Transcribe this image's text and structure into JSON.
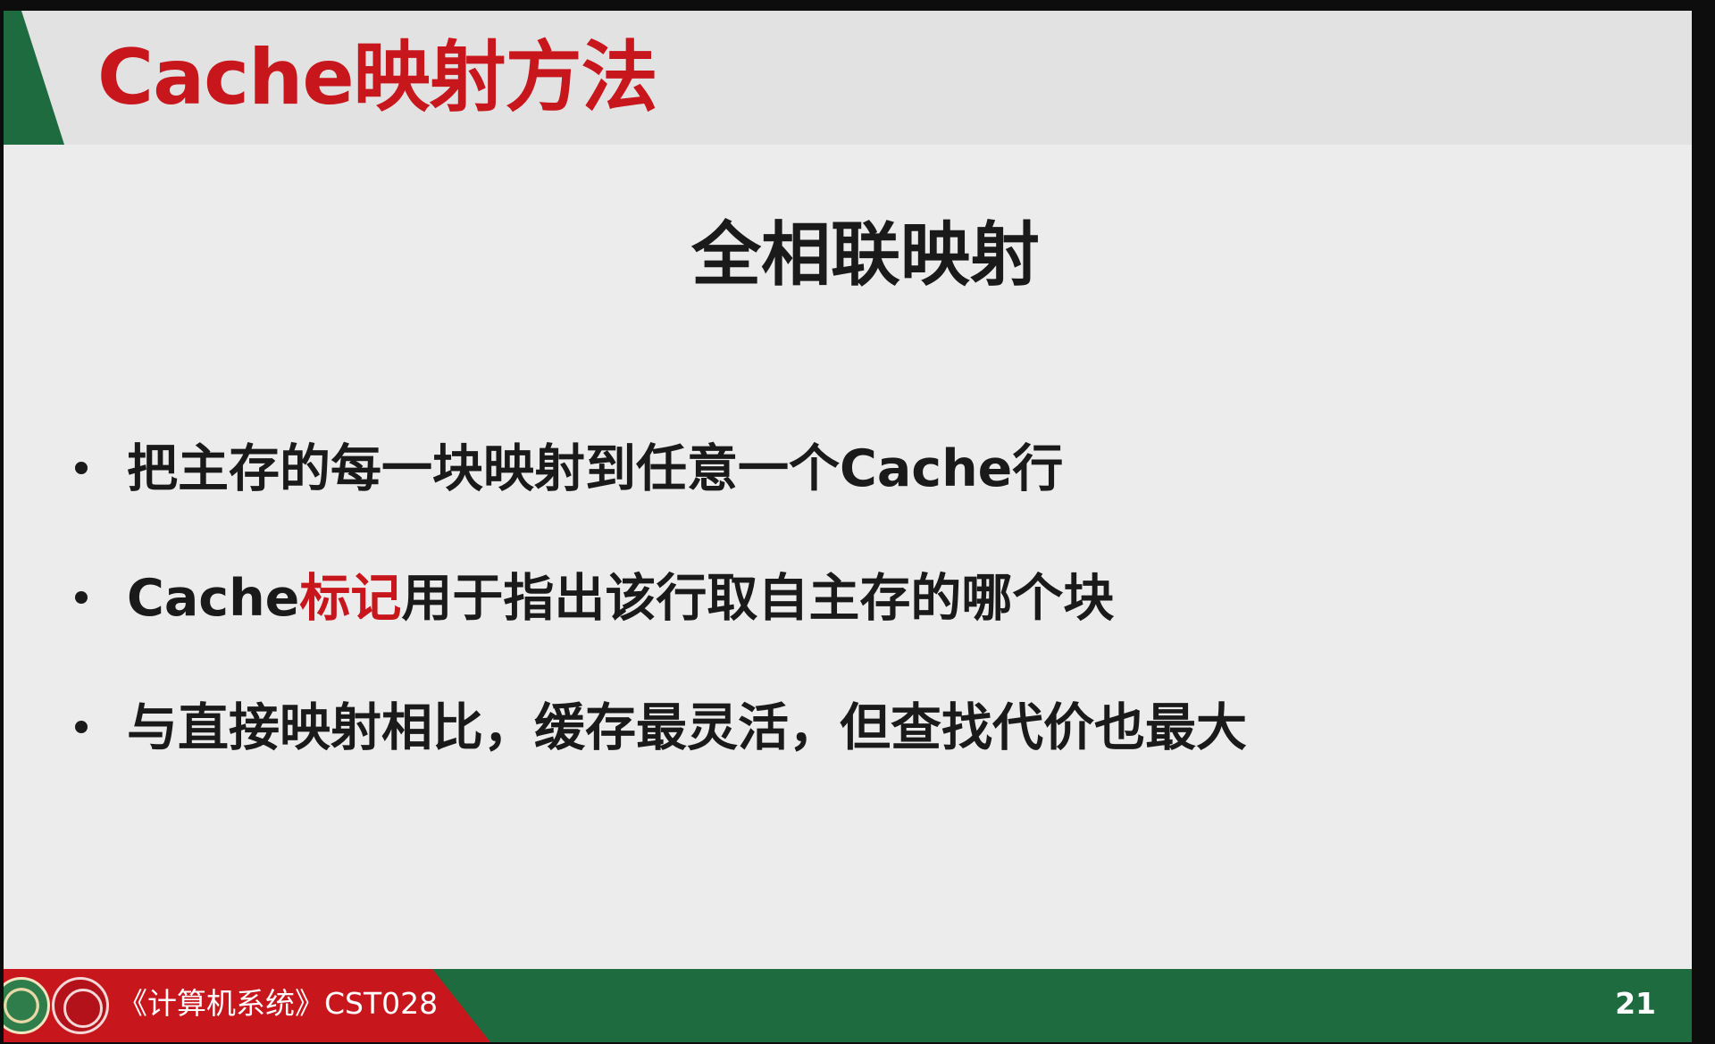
{
  "header": {
    "title": "Cache映射方法"
  },
  "main": {
    "subtitle": "全相联映射",
    "bullets": [
      {
        "text": "把主存的每一块映射到任意一个Cache行"
      },
      {
        "prefix": "Cache",
        "highlight": "标记",
        "suffix": "用于指出该行取自主存的哪个块"
      },
      {
        "text": "与直接映射相比，缓存最灵活，但查找代价也最大"
      }
    ]
  },
  "footer": {
    "course": "《计算机系统》CST028",
    "page_number": "21"
  },
  "colors": {
    "accent_red": "#c8161d",
    "accent_green": "#1d6b3e",
    "background": "#ececec"
  }
}
